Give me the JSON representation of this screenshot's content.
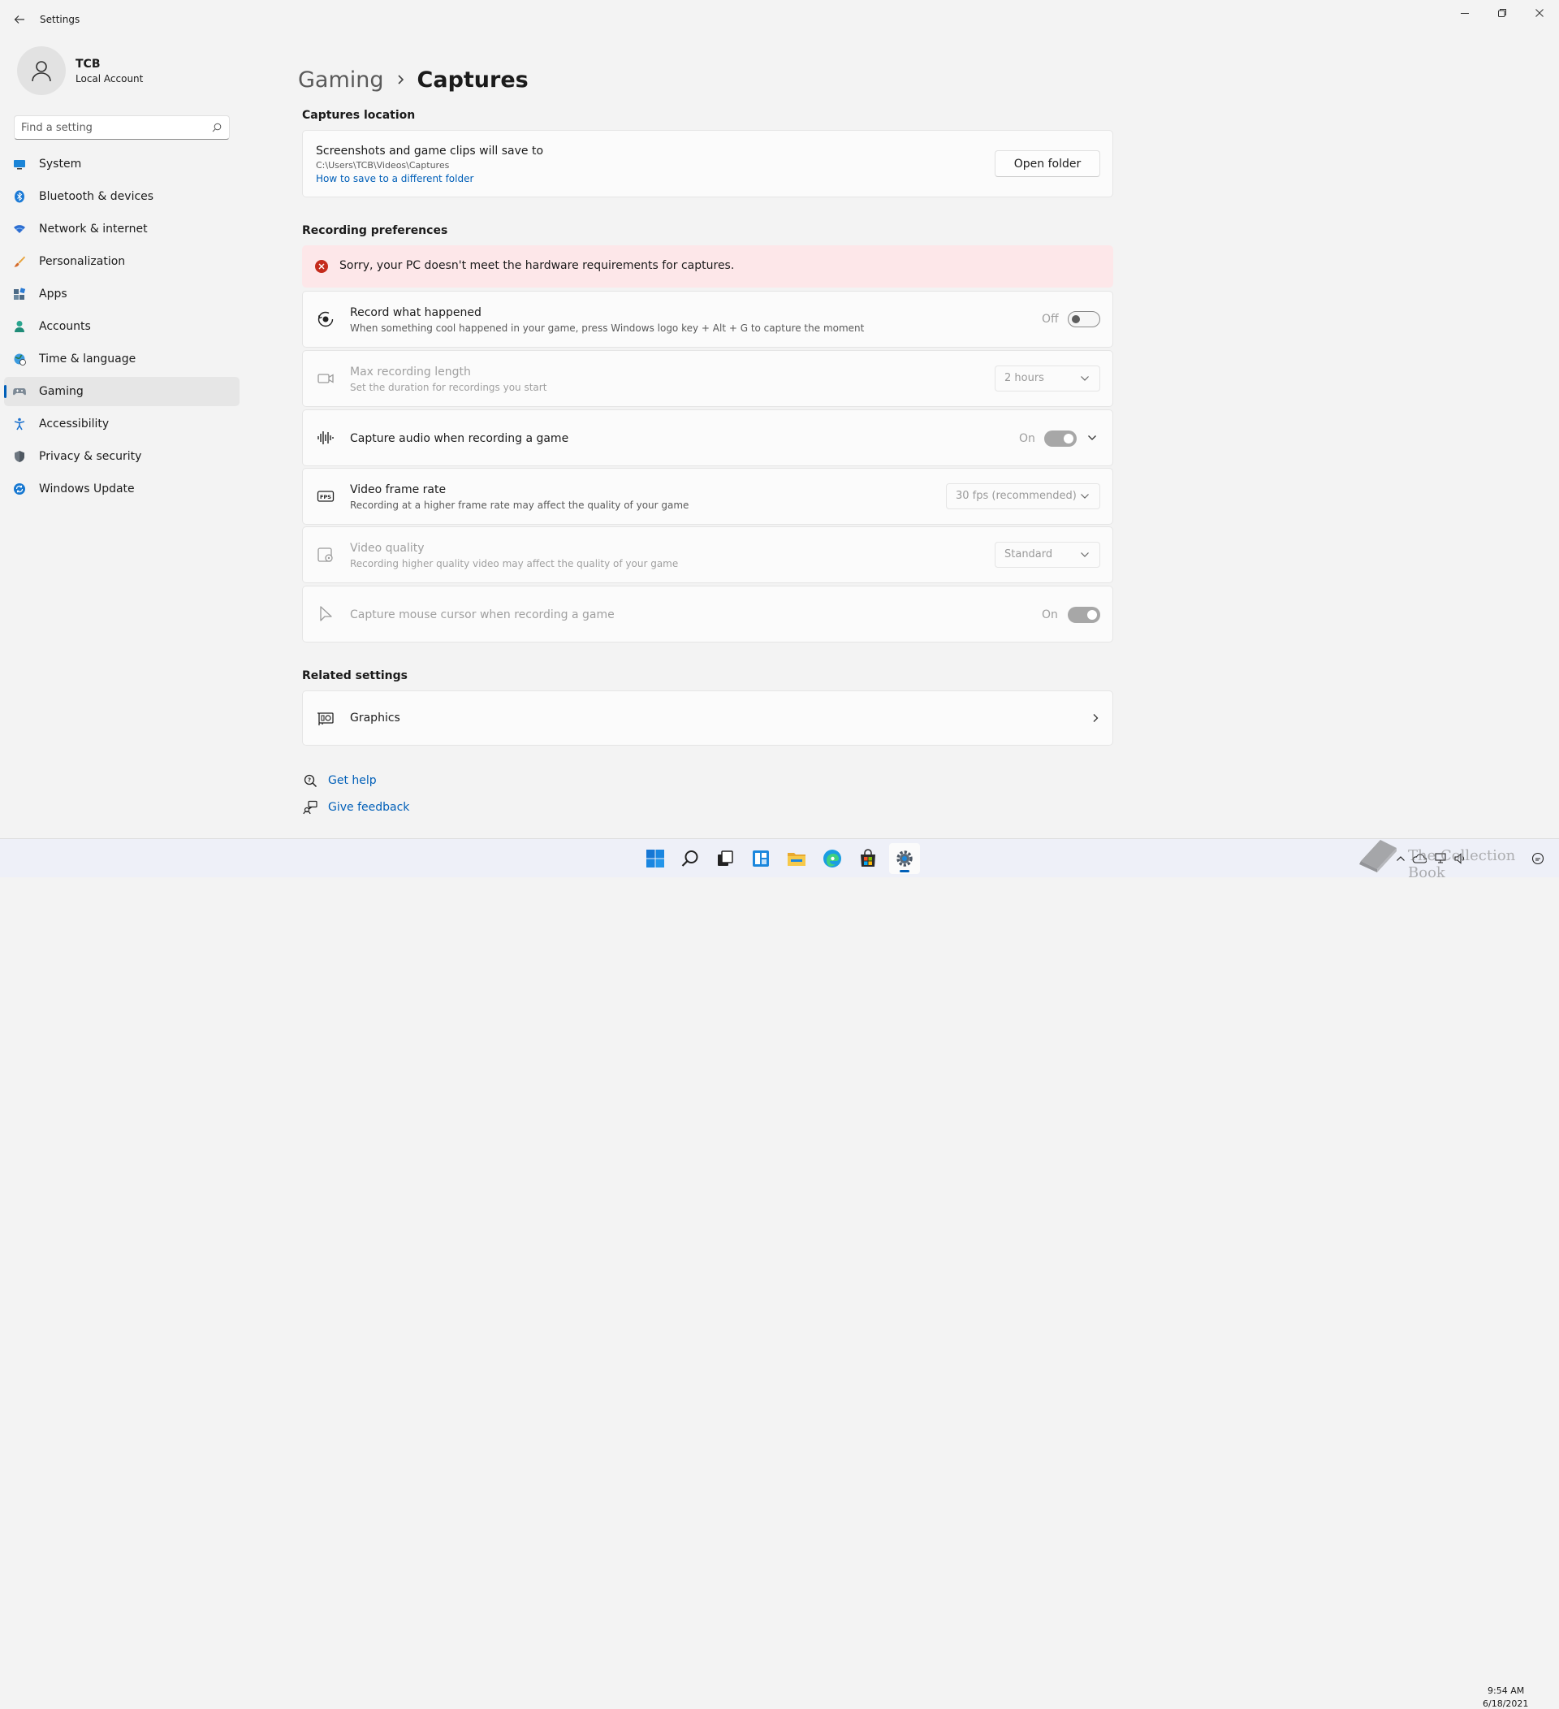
{
  "window": {
    "title": "Settings"
  },
  "user": {
    "name": "TCB",
    "account_type": "Local Account"
  },
  "search": {
    "placeholder": "Find a setting"
  },
  "sidebar": {
    "items": [
      {
        "label": "System",
        "icon": "monitor-icon",
        "selected": false
      },
      {
        "label": "Bluetooth & devices",
        "icon": "bluetooth-icon",
        "selected": false
      },
      {
        "label": "Network & internet",
        "icon": "wifi-icon",
        "selected": false
      },
      {
        "label": "Personalization",
        "icon": "brush-icon",
        "selected": false
      },
      {
        "label": "Apps",
        "icon": "apps-icon",
        "selected": false
      },
      {
        "label": "Accounts",
        "icon": "person-icon",
        "selected": false
      },
      {
        "label": "Time & language",
        "icon": "globe-clock-icon",
        "selected": false
      },
      {
        "label": "Gaming",
        "icon": "gamepad-icon",
        "selected": true
      },
      {
        "label": "Accessibility",
        "icon": "accessibility-icon",
        "selected": false
      },
      {
        "label": "Privacy & security",
        "icon": "shield-icon",
        "selected": false
      },
      {
        "label": "Windows Update",
        "icon": "update-icon",
        "selected": false
      }
    ]
  },
  "breadcrumb": {
    "parent": "Gaming",
    "current": "Captures"
  },
  "captures_location": {
    "heading": "Captures location",
    "title": "Screenshots and game clips will save to",
    "path": "C:\\Users\\TCB\\Videos\\Captures",
    "link": "How to save to a different folder",
    "button": "Open folder"
  },
  "recording": {
    "heading": "Recording preferences",
    "error": "Sorry, your PC doesn't meet the hardware requirements for captures.",
    "record_what_happened": {
      "title": "Record what happened",
      "desc": "When something cool happened in your game, press Windows logo key + Alt + G to capture the moment",
      "state_label": "Off"
    },
    "max_length": {
      "title": "Max recording length",
      "desc": "Set the duration for recordings you start",
      "value": "2 hours"
    },
    "capture_audio": {
      "title": "Capture audio when recording a game",
      "state_label": "On"
    },
    "frame_rate": {
      "title": "Video frame rate",
      "desc": "Recording at a higher frame rate may affect the quality of your game",
      "value": "30 fps (recommended)"
    },
    "video_quality": {
      "title": "Video quality",
      "desc": "Recording higher quality video may affect the quality of your game",
      "value": "Standard"
    },
    "mouse_cursor": {
      "title": "Capture mouse cursor when recording a game",
      "state_label": "On"
    }
  },
  "related": {
    "heading": "Related settings",
    "graphics": "Graphics"
  },
  "help": {
    "get_help": "Get help",
    "give_feedback": "Give feedback"
  },
  "taskbar": {
    "apps": [
      "windows-start-icon",
      "search-icon",
      "task-view-icon",
      "widgets-icon",
      "file-explorer-icon",
      "edge-icon",
      "store-icon",
      "settings-icon"
    ],
    "time": "9:54 AM",
    "date": "6/18/2021",
    "watermark": "The Collection Book"
  },
  "colors": {
    "accent": "#005fb8",
    "error_bg": "#fde7e9",
    "error_icon": "#c42b1c",
    "sidebar_selected": "#e6e6e6"
  }
}
